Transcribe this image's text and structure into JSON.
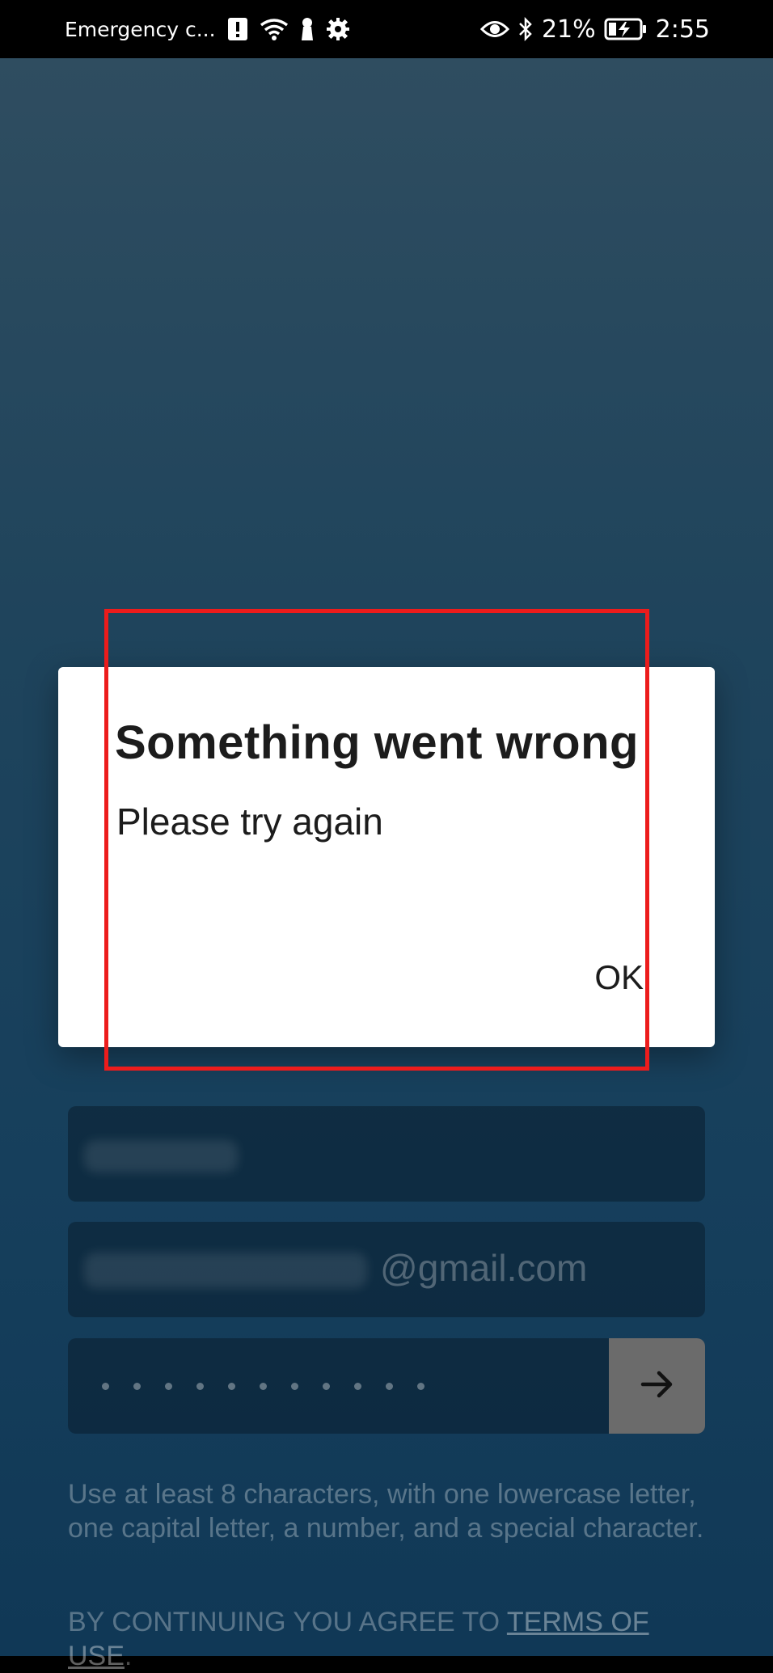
{
  "status_bar": {
    "carrier": "Emergency c...",
    "battery_percent": "21%",
    "time": "2:55",
    "icons_left": [
      "alert-icon",
      "wifi-icon",
      "keyhole-icon",
      "gear-icon"
    ],
    "icons_right": [
      "eye-icon",
      "bluetooth-icon",
      "battery-charging-icon"
    ]
  },
  "form": {
    "email_suffix": "@gmail.com",
    "password_mask_count": 11,
    "submit_icon": "arrow-right-icon",
    "helper_text": "Use at least 8 characters, with one lowercase letter, one capital letter, a number, and a special character.",
    "terms_prefix": "BY CONTINUING YOU AGREE TO ",
    "terms_link": "TERMS OF USE",
    "terms_suffix": "."
  },
  "dialog": {
    "title": "Something went wrong",
    "message": "Please try again",
    "ok_label": "OK"
  },
  "colors": {
    "highlight_border": "#ec1c1c",
    "dialog_background": "#ffffff",
    "submit_button": "#6b6b6b"
  }
}
